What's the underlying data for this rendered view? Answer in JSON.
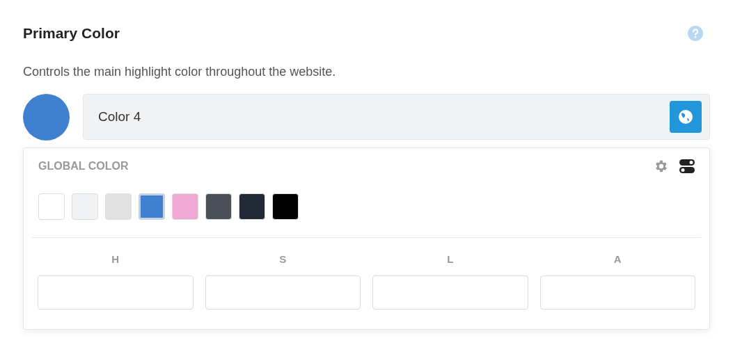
{
  "title": "Primary Color",
  "description": "Controls the main highlight color throughout the website.",
  "preview": {
    "color": "#4080d0"
  },
  "color_field": {
    "value": "Color 4"
  },
  "picker": {
    "heading": "GLOBAL COLOR",
    "swatches": [
      {
        "color": "#ffffff",
        "selected": false
      },
      {
        "color": "#f1f2f4",
        "selected": false
      },
      {
        "color": "#e2e2e2",
        "selected": false
      },
      {
        "color": "#4080d0",
        "selected": true
      },
      {
        "color": "#f0a8d4",
        "selected": false
      },
      {
        "color": "#4b4f58",
        "selected": false
      },
      {
        "color": "#212934",
        "selected": false
      },
      {
        "color": "#000000",
        "selected": false
      }
    ],
    "channels": [
      {
        "label": "H"
      },
      {
        "label": "S"
      },
      {
        "label": "L"
      },
      {
        "label": "A"
      }
    ]
  }
}
